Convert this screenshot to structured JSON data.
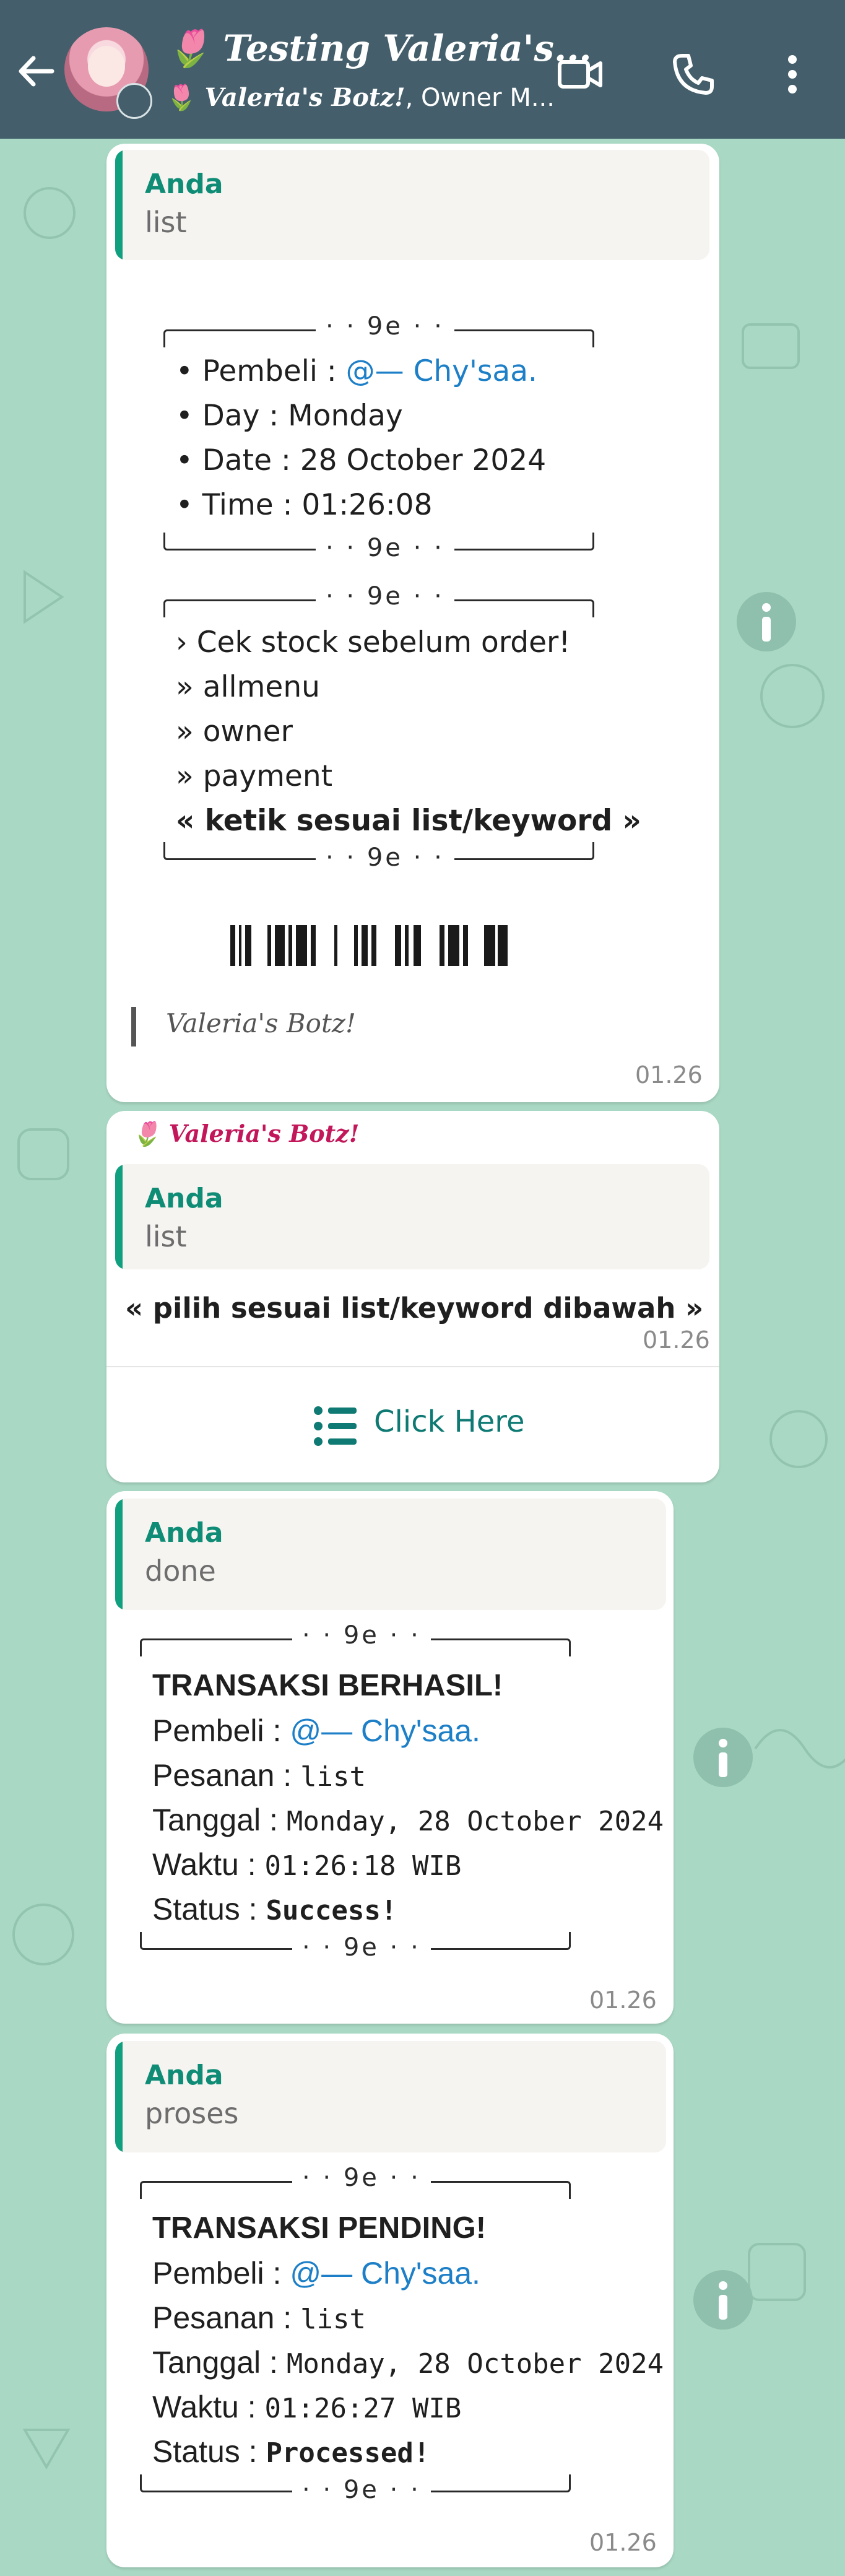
{
  "header": {
    "title_prefix": "🌷",
    "title": "Testing Valeria's...",
    "subtitle_prefix": "🌷",
    "subtitle_bot": "Valeria's Botz!",
    "subtitle_rest": ", Owner M..."
  },
  "msg1": {
    "quote_author": "Anda",
    "quote_text": "list",
    "ornament": "· · 9e · ·",
    "info_lines": [
      "• Pembeli : ",
      "• Day : Monday",
      "• Date : 28 October 2024",
      "• Time : 01:26:08"
    ],
    "buyer_mention": "@— Chy'saa.",
    "menu_lines": [
      "› Cek stock sebelum order!",
      "» allmenu",
      "» owner",
      "» payment",
      "« ketik sesuai list/keyword »"
    ],
    "signature": "Valeria's Botz!",
    "time": "01.26"
  },
  "msg2": {
    "sender_prefix": "🌷",
    "sender": "Valeria's Botz!",
    "quote_author": "Anda",
    "quote_text": "list",
    "body": "« pilih sesuai list/keyword dibawah »",
    "time": "01.26",
    "button_label": "Click Here"
  },
  "msg3": {
    "quote_author": "Anda",
    "quote_text": "done",
    "ornament": "· · 9e · ·",
    "heading": "TRANSAKSI BERHASIL!",
    "buyer_label": "Pembeli : ",
    "buyer_mention": "@— Chy'saa.",
    "order_label": "Pesanan : ",
    "order_value": "list",
    "date_label": "Tanggal : ",
    "date_value": "Monday, 28 October 2024",
    "time_label": "Waktu : ",
    "time_value": "01:26:18 WIB",
    "status_label": "Status : ",
    "status_value": "Success!",
    "time": "01.26"
  },
  "msg4": {
    "quote_author": "Anda",
    "quote_text": "proses",
    "ornament": "· · 9e · ·",
    "heading": "TRANSAKSI PENDING!",
    "buyer_label": "Pembeli : ",
    "buyer_mention": "@— Chy'saa.",
    "order_label": "Pesanan : ",
    "order_value": "list",
    "date_label": "Tanggal : ",
    "date_value": "Monday, 28 October 2024",
    "time_label": "Waktu : ",
    "time_value": "01:26:27 WIB",
    "status_label": "Status : ",
    "status_value": "Processed!",
    "time": "01.26"
  },
  "icons": [
    "back-arrow-icon",
    "video-call-icon",
    "voice-call-icon",
    "more-options-icon",
    "info-icon",
    "list-icon"
  ],
  "colors": {
    "header": "#445f6b",
    "chat_bg": "#a9d9c4",
    "accent": "#10a080",
    "mention": "#1d7fc7",
    "button_text": "#0f7a73"
  }
}
